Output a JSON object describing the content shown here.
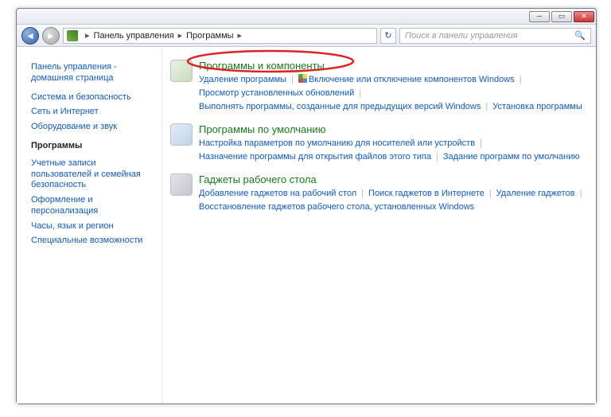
{
  "breadcrumbs": {
    "root": "Панель управления",
    "current": "Программы"
  },
  "search": {
    "placeholder": "Поиск в панели управления"
  },
  "sidebar": {
    "home_label": "Панель управления - домашняя страница",
    "items": [
      {
        "label": "Система и безопасность"
      },
      {
        "label": "Сеть и Интернет"
      },
      {
        "label": "Оборудование и звук"
      },
      {
        "label": "Программы",
        "current": true
      },
      {
        "label": "Учетные записи пользователей и семейная безопасность"
      },
      {
        "label": "Оформление и персонализация"
      },
      {
        "label": "Часы, язык и регион"
      },
      {
        "label": "Специальные возможности"
      }
    ]
  },
  "sections": [
    {
      "title": "Программы и компоненты",
      "links": [
        {
          "label": "Удаление программы"
        },
        {
          "label": "Включение или отключение компонентов Windows",
          "shield": true
        },
        {
          "label": "Просмотр установленных обновлений",
          "break_after": true
        },
        {
          "label": "Выполнять программы, созданные для предыдущих версий Windows"
        },
        {
          "label": "Установка программы"
        }
      ]
    },
    {
      "title": "Программы по умолчанию",
      "links": [
        {
          "label": "Настройка параметров по умолчанию для носителей или устройств",
          "break_after": true
        },
        {
          "label": "Назначение программы для открытия файлов этого типа"
        },
        {
          "label": "Задание программ по умолчанию"
        }
      ]
    },
    {
      "title": "Гаджеты рабочего стола",
      "links": [
        {
          "label": "Добавление гаджетов на рабочий стол"
        },
        {
          "label": "Поиск гаджетов в Интернете"
        },
        {
          "label": "Удаление гаджетов",
          "break_after": true
        },
        {
          "label": "Восстановление гаджетов рабочего стола, установленных Windows"
        }
      ]
    }
  ]
}
